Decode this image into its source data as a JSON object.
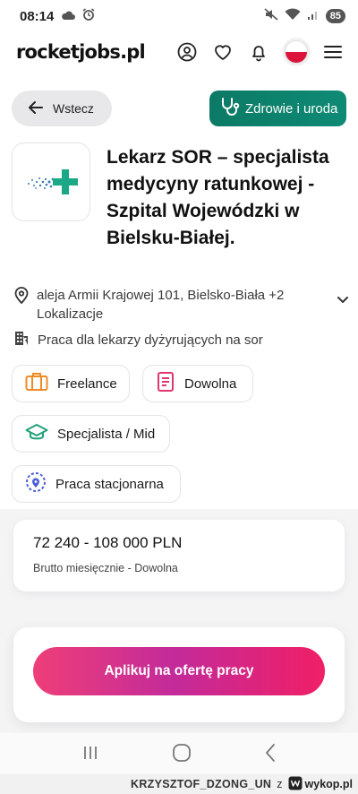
{
  "status_bar": {
    "time": "08:14",
    "battery": "85"
  },
  "header": {
    "logo": "rocketjobs.pl"
  },
  "nav": {
    "back_label": "Wstecz",
    "category_label": "Zdrowie i uroda"
  },
  "job": {
    "title": "Lekarz SOR – specjalista medycyny ratunkowej - Szpital Wojewódzki w Bielsku-Białej.",
    "location": "aleja Armii Krajowej 101, Bielsko-Biała +2 Lokalizacje",
    "category": "Praca dla lekarzy dyżyrujących na sor"
  },
  "tags": {
    "contract": "Freelance",
    "type": "Dowolna",
    "level": "Specjalista / Mid",
    "workplace": "Praca stacjonarna"
  },
  "salary": {
    "amount": "72 240 - 108 000 PLN",
    "note": "Brutto miesięcznie - Dowolna"
  },
  "apply": {
    "label": "Aplikuj na ofertę pracy"
  },
  "watermark": {
    "user": "KRZYSZTOF_DZONG_UN",
    "word": "z",
    "site": "wykop.pl"
  },
  "colors": {
    "accent_green": "#0c7a66",
    "apply_gradient_start": "#ee3e78",
    "apply_gradient_mid": "#c32b9a",
    "apply_gradient_end": "#f01f66",
    "flag_red": "#dc143c"
  }
}
